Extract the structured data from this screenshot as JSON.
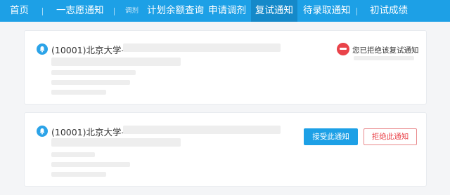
{
  "nav": {
    "items": [
      {
        "label": "首页"
      },
      {
        "label": "一志愿通知"
      },
      {
        "label": "调剂"
      },
      {
        "label": "计划余额查询"
      },
      {
        "label": "申请调剂"
      },
      {
        "label": "复试通知"
      },
      {
        "label": "待录取通知"
      },
      {
        "label": "初试成绩"
      }
    ],
    "active": "复试通知"
  },
  "notices": [
    {
      "title": "(10001)北京大学–",
      "status_text": "您已拒绝该复试通知"
    },
    {
      "title": "(10001)北京大学–",
      "accept_label": "接受此通知",
      "reject_label": "拒绝此通知"
    }
  ],
  "colors": {
    "nav_bg": "#1da0e6",
    "nav_active_bg": "#1589c9",
    "accept": "#1da0e6",
    "reject": "#e9434a"
  }
}
